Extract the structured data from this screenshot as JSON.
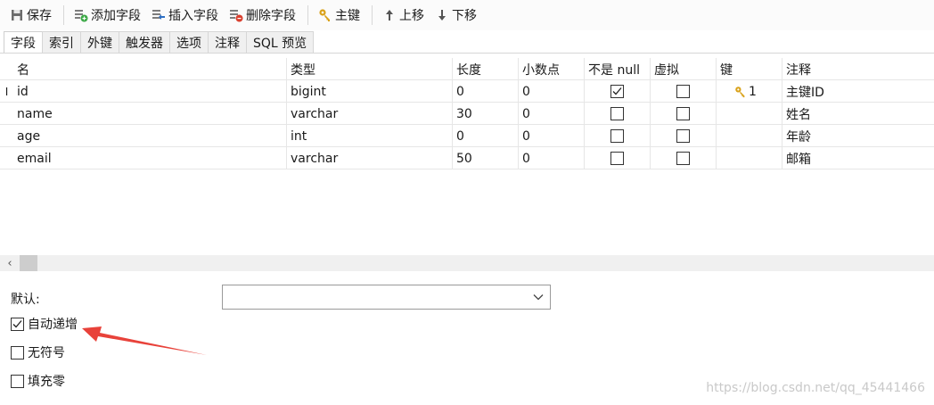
{
  "toolbar": {
    "save": "保存",
    "add_field": "添加字段",
    "insert_field": "插入字段",
    "delete_field": "删除字段",
    "primary_key": "主键",
    "move_up": "上移",
    "move_down": "下移"
  },
  "tabs": [
    "字段",
    "索引",
    "外键",
    "触发器",
    "选项",
    "注释",
    "SQL 预览"
  ],
  "columns": [
    "名",
    "类型",
    "长度",
    "小数点",
    "不是 null",
    "虚拟",
    "键",
    "注释"
  ],
  "rows": [
    {
      "name": "id",
      "type": "bigint",
      "length": "0",
      "decimals": "0",
      "not_null": true,
      "virtual": false,
      "key": "1",
      "comment": "主键ID"
    },
    {
      "name": "name",
      "type": "varchar",
      "length": "30",
      "decimals": "0",
      "not_null": false,
      "virtual": false,
      "key": "",
      "comment": "姓名"
    },
    {
      "name": "age",
      "type": "int",
      "length": "0",
      "decimals": "0",
      "not_null": false,
      "virtual": false,
      "key": "",
      "comment": "年龄"
    },
    {
      "name": "email",
      "type": "varchar",
      "length": "50",
      "decimals": "0",
      "not_null": false,
      "virtual": false,
      "key": "",
      "comment": "邮箱"
    }
  ],
  "row_marker": "I",
  "props": {
    "default_label": "默认:",
    "default_value": "",
    "auto_increment": {
      "label": "自动递增",
      "checked": true
    },
    "unsigned": {
      "label": "无符号",
      "checked": false
    },
    "zerofill": {
      "label": "填充零",
      "checked": false
    }
  },
  "watermark": "https://blog.csdn.net/qq_45441466",
  "colors": {
    "annotation_arrow": "#e8423a",
    "key_icon": "#d9a21b"
  }
}
